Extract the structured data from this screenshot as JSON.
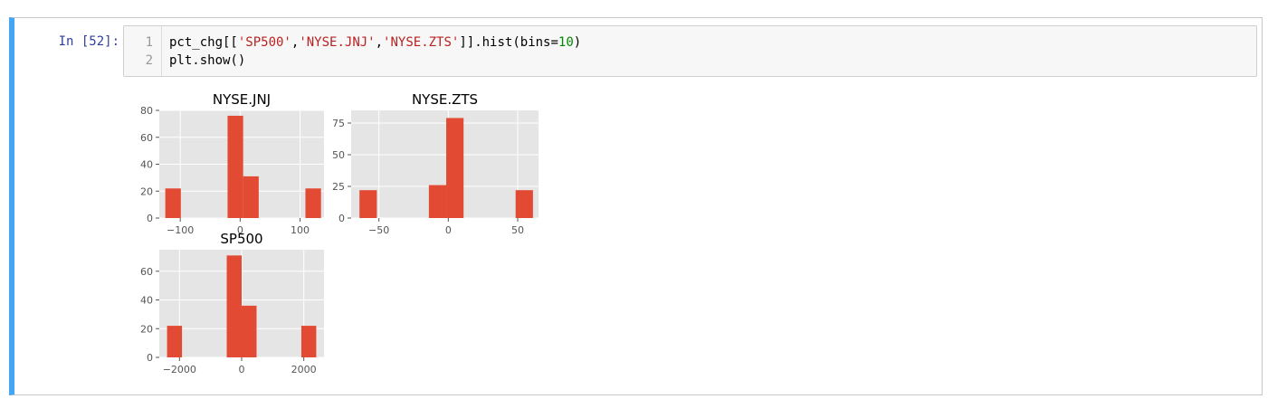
{
  "cell": {
    "prompt": "In [52]:",
    "lines": [
      {
        "num": "1",
        "parts": [
          {
            "text": "pct_chg[[",
            "cls": ""
          },
          {
            "text": "'SP500'",
            "cls": "str"
          },
          {
            "text": ",",
            "cls": ""
          },
          {
            "text": "'NYSE.JNJ'",
            "cls": "str"
          },
          {
            "text": ",",
            "cls": ""
          },
          {
            "text": "'NYSE.ZTS'",
            "cls": "str"
          },
          {
            "text": "]].hist(bins=",
            "cls": ""
          },
          {
            "text": "10",
            "cls": "num"
          },
          {
            "text": ")",
            "cls": ""
          }
        ]
      },
      {
        "num": "2",
        "parts": [
          {
            "text": "plt.show()",
            "cls": ""
          }
        ]
      }
    ]
  },
  "colors": {
    "bar": "#e24a33",
    "plot_bg": "#e5e5e5",
    "grid": "#ffffff",
    "tick_text": "#555555",
    "title_text": "#000000"
  },
  "chart_data": [
    {
      "type": "bar",
      "title": "NYSE.JNJ",
      "xlim": [
        -135,
        140
      ],
      "ylim": [
        0,
        80
      ],
      "xticks": [
        -100,
        0,
        100
      ],
      "xtick_labels": [
        "−100",
        "0",
        "100"
      ],
      "yticks": [
        0,
        20,
        40,
        60,
        80
      ],
      "bin_edges": [
        -125,
        -99,
        -73,
        -47,
        -21,
        5,
        31,
        57,
        83,
        109,
        135
      ],
      "counts": [
        22,
        0,
        0,
        0,
        76,
        31,
        0,
        0,
        0,
        22
      ],
      "grid": true
    },
    {
      "type": "bar",
      "title": "NYSE.ZTS",
      "xlim": [
        -70,
        65
      ],
      "ylim": [
        0,
        85
      ],
      "xticks": [
        -50,
        0,
        50
      ],
      "xtick_labels": [
        "−50",
        "0",
        "50"
      ],
      "yticks": [
        0,
        25,
        50,
        75
      ],
      "bin_edges": [
        -64,
        -51.5,
        -39,
        -26.5,
        -14,
        -1.5,
        11,
        23.5,
        36,
        48.5,
        61
      ],
      "counts": [
        22,
        0,
        0,
        0,
        26,
        79,
        0,
        0,
        0,
        22
      ],
      "grid": true
    },
    {
      "type": "bar",
      "title": "SP500",
      "xlim": [
        -2650,
        2650
      ],
      "ylim": [
        0,
        75
      ],
      "xticks": [
        -2000,
        0,
        2000
      ],
      "xtick_labels": [
        "−2000",
        "0",
        "2000"
      ],
      "yticks": [
        0,
        20,
        40,
        60
      ],
      "bin_edges": [
        -2400,
        -1920,
        -1440,
        -960,
        -480,
        0,
        480,
        960,
        1440,
        1920,
        2400
      ],
      "counts": [
        22,
        0,
        0,
        0,
        71,
        36,
        0,
        0,
        0,
        22
      ],
      "grid": true
    }
  ]
}
